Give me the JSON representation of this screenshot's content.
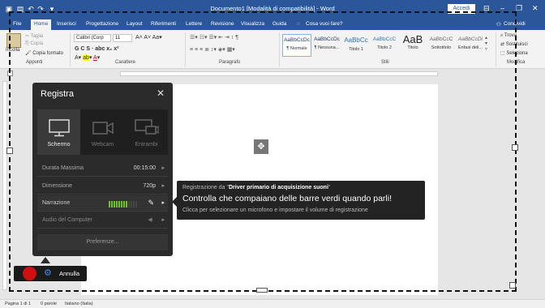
{
  "titlebar": {
    "doc_title": "Documento1 [Modalità di compatibilità] - Word",
    "signin": "Accedi",
    "min": "–",
    "max": "❐",
    "close": "✕",
    "ribbon_opts": "⊟"
  },
  "tabs": [
    "File",
    "Home",
    "Inserisci",
    "Progettazione",
    "Layout",
    "Riferimenti",
    "Lettere",
    "Revisione",
    "Visualizza",
    "Guida",
    "Cosa vuoi fare?"
  ],
  "share": "Condividi",
  "ribbon": {
    "clipboard": {
      "paste": "Incolla",
      "cut": "Taglia",
      "copy": "Copia",
      "format_painter": "Copia formato",
      "label": "Appunti"
    },
    "font": {
      "name": "Calibri (Corp",
      "size": "11",
      "label": "Carattere"
    },
    "paragraph": {
      "label": "Paragrafo"
    },
    "styles": {
      "label": "Stili",
      "items": [
        {
          "sample": "AaBbCcDc",
          "name": "¶ Normale"
        },
        {
          "sample": "AaBbCcDc",
          "name": "¶ Nessuna..."
        },
        {
          "sample": "AaBbCc",
          "name": "Titolo 1"
        },
        {
          "sample": "AaBbCcC",
          "name": "Titolo 2"
        },
        {
          "sample": "AaB",
          "name": "Titolo"
        },
        {
          "sample": "AaBbCcC",
          "name": "Sottotitolo"
        },
        {
          "sample": "AaBbCcDi",
          "name": "Enfasi deli..."
        }
      ]
    },
    "editing": {
      "find": "Trova",
      "replace": "Sostituisci",
      "select": "Seleziona",
      "label": "Modifica"
    }
  },
  "status": {
    "page": "Pagina 1 di 1",
    "words": "0 parole",
    "lang": "Italiano (Italia)"
  },
  "recorder": {
    "title": "Registra",
    "close": "✕",
    "sources": [
      {
        "label": "Schermo",
        "icon": "monitor-icon"
      },
      {
        "label": "Webcam",
        "icon": "webcam-icon"
      },
      {
        "label": "Entrambi",
        "icon": "both-icon"
      }
    ],
    "settings": [
      {
        "key": "Durata Massima",
        "value": "00:15:00"
      },
      {
        "key": "Dimensione",
        "value": "720p"
      },
      {
        "key": "Narrazione",
        "value": ""
      },
      {
        "key": "Audio del Computer",
        "value": ""
      }
    ],
    "preferences": "Preferenze..."
  },
  "tooltip": {
    "line1_prefix": "Registrazione da \"",
    "line1_bold": "Driver primario di acquisizione suoni",
    "line1_suffix": "\"",
    "line2": "Controlla che compaiano delle barre verdi quando parli!",
    "line3": "Clicca per selezionare un microfono e impostare il volume di registrazione"
  },
  "bottom_bar": {
    "cancel": "Annulla"
  },
  "colors": {
    "word_blue": "#2b579a",
    "record_red": "#d01010",
    "mic_green": "#6fc21f"
  }
}
